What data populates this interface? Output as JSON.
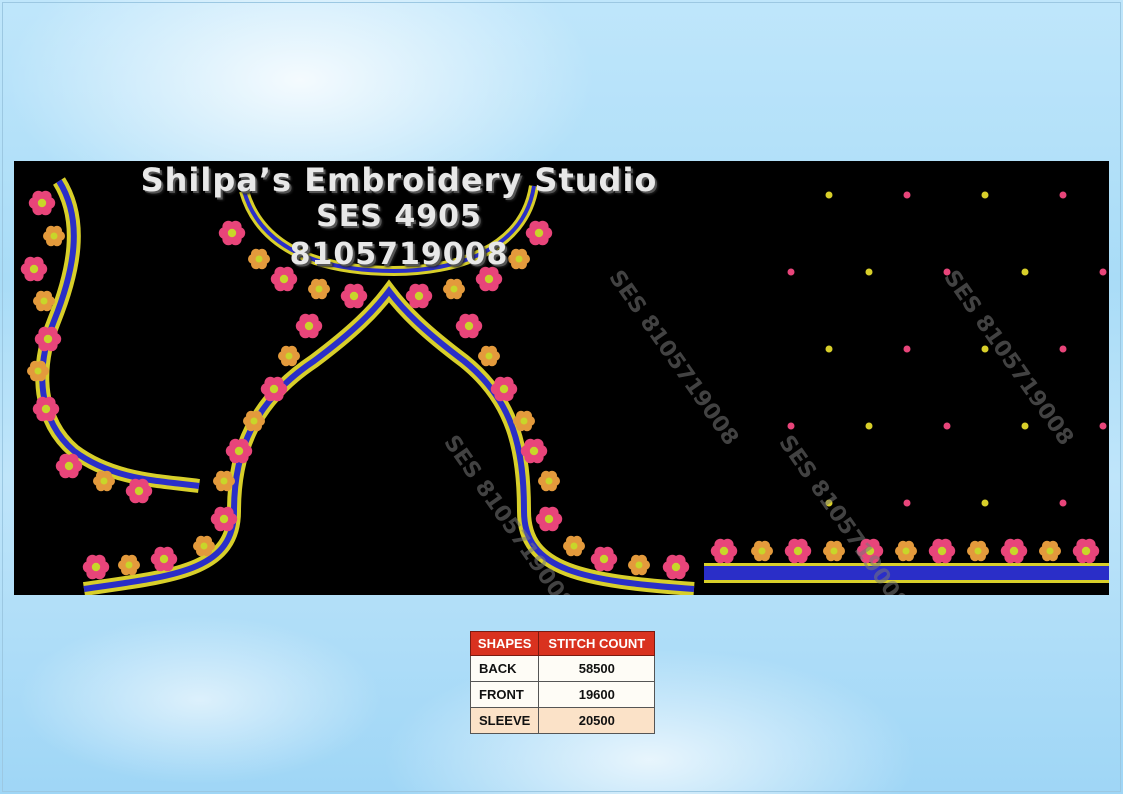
{
  "design": {
    "studio_name": "Shilpa’s Embroidery Studio",
    "design_code": "SES 4905",
    "phone": "8105719008",
    "watermark_text": "SES 8105719008",
    "colors": {
      "background": "#000000",
      "piping_blue": "#2a2ec8",
      "gold": "#d8cf2a",
      "flower_pink": "#e8457a",
      "flower_orange": "#e39a3c",
      "leaf_green": "#c8d62a"
    }
  },
  "stitch_table": {
    "headers": [
      "SHAPES",
      "STITCH COUNT"
    ],
    "rows": [
      {
        "shape": "BACK",
        "count": "58500"
      },
      {
        "shape": "FRONT",
        "count": "19600"
      },
      {
        "shape": "SLEEVE",
        "count": "20500"
      }
    ]
  }
}
